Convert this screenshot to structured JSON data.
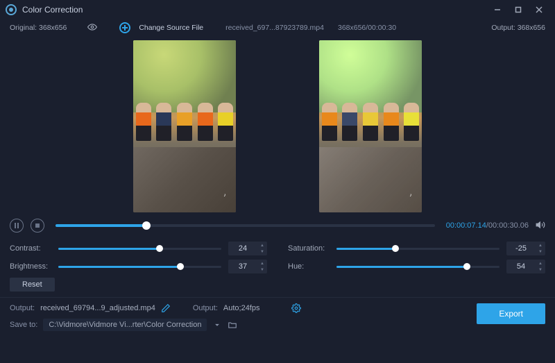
{
  "titlebar": {
    "title": "Color Correction"
  },
  "subbar": {
    "original_label": "Original: 368x656",
    "change_source_label": "Change Source File",
    "filename": "received_697...87923789.mp4",
    "fileinfo": "368x656/00:00:30",
    "output_label": "Output: 368x656"
  },
  "playback": {
    "current_time": "00:00:07.14",
    "total_time": "/00:00:30.06",
    "progress_pct": 24
  },
  "sliders": {
    "contrast": {
      "label": "Contrast:",
      "value": "24",
      "pct": 62
    },
    "brightness": {
      "label": "Brightness:",
      "value": "37",
      "pct": 75
    },
    "saturation": {
      "label": "Saturation:",
      "value": "-25",
      "pct": 36
    },
    "hue": {
      "label": "Hue:",
      "value": "54",
      "pct": 80
    }
  },
  "reset": {
    "label": "Reset"
  },
  "output": {
    "output_label": "Output:",
    "output_file": "received_69794...9_adjusted.mp4",
    "output2_label": "Output:",
    "output2_val": "Auto;24fps",
    "saveto_label": "Save to:",
    "saveto_path": "C:\\Vidmore\\Vidmore Vi...rter\\Color Correction"
  },
  "export": {
    "label": "Export"
  },
  "colors": {
    "vest_orig": [
      "#e8681c",
      "#2a3858",
      "#e8a028",
      "#e8681c",
      "#e8d028"
    ],
    "vest_adj": [
      "#e8881c",
      "#3a4868",
      "#e8c838",
      "#e8881c",
      "#e8e038"
    ]
  }
}
